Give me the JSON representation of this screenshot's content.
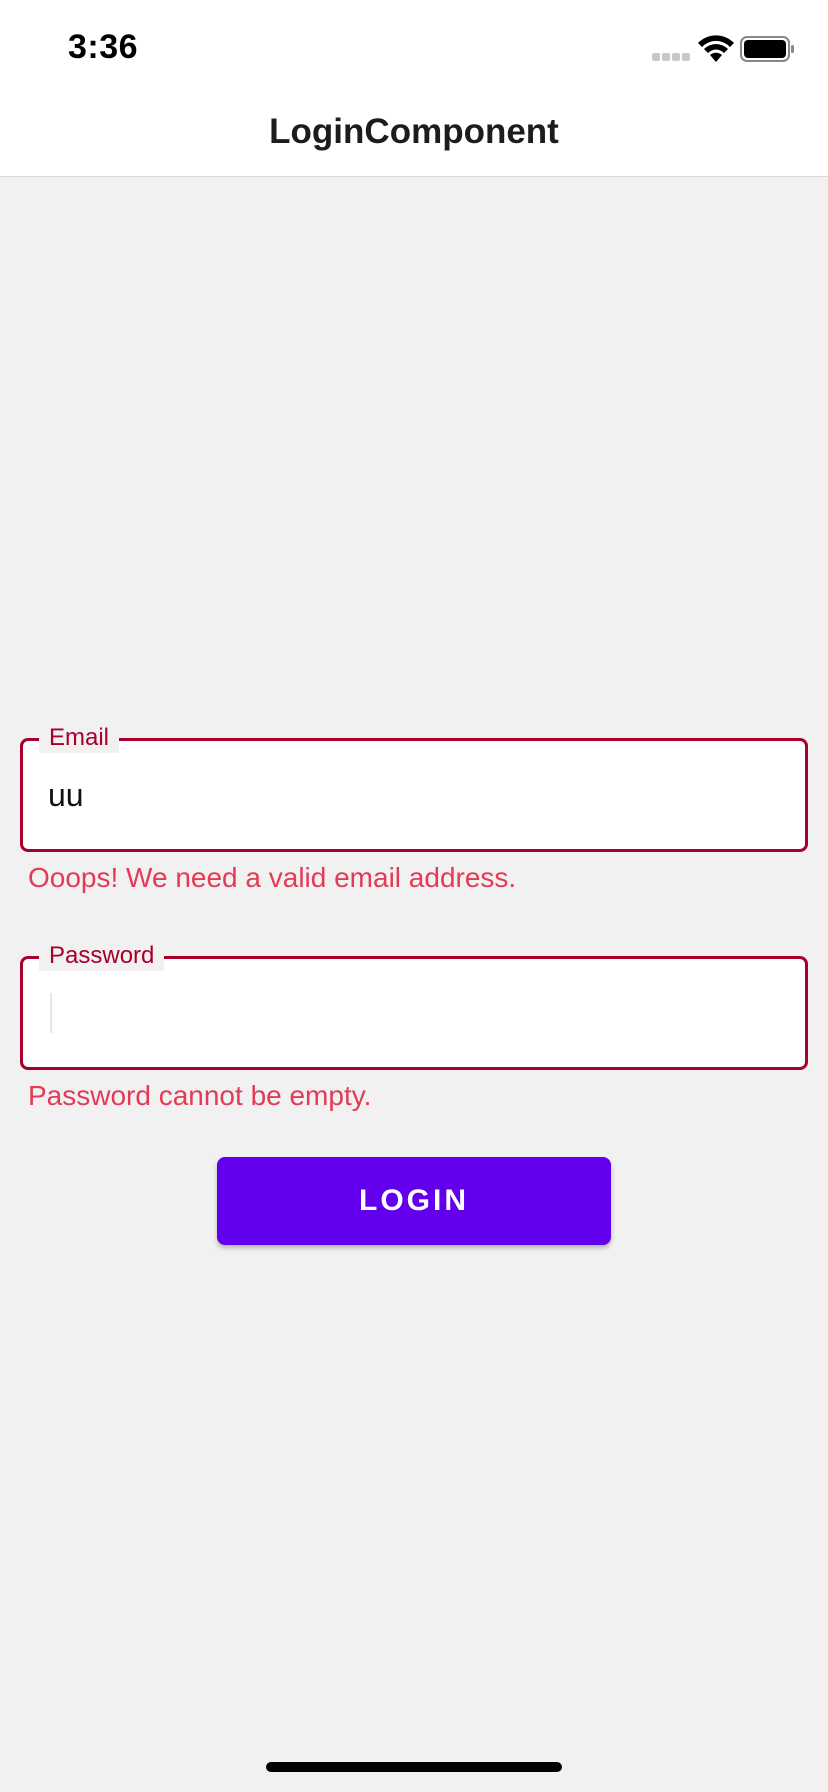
{
  "status_bar": {
    "time": "3:36",
    "icons": [
      "signal-icon",
      "wifi-icon",
      "battery-icon"
    ]
  },
  "nav": {
    "title": "LoginComponent"
  },
  "form": {
    "email": {
      "label": "Email",
      "value": "uu",
      "error": "Ooops! We need a valid email address."
    },
    "password": {
      "label": "Password",
      "value": "",
      "error": "Password cannot be empty."
    },
    "login_label": "LOGIN"
  },
  "colors": {
    "error_border": "#a8002a",
    "error_text": "#e53a55",
    "button": "#6200ee",
    "background": "#f1f1f1"
  }
}
